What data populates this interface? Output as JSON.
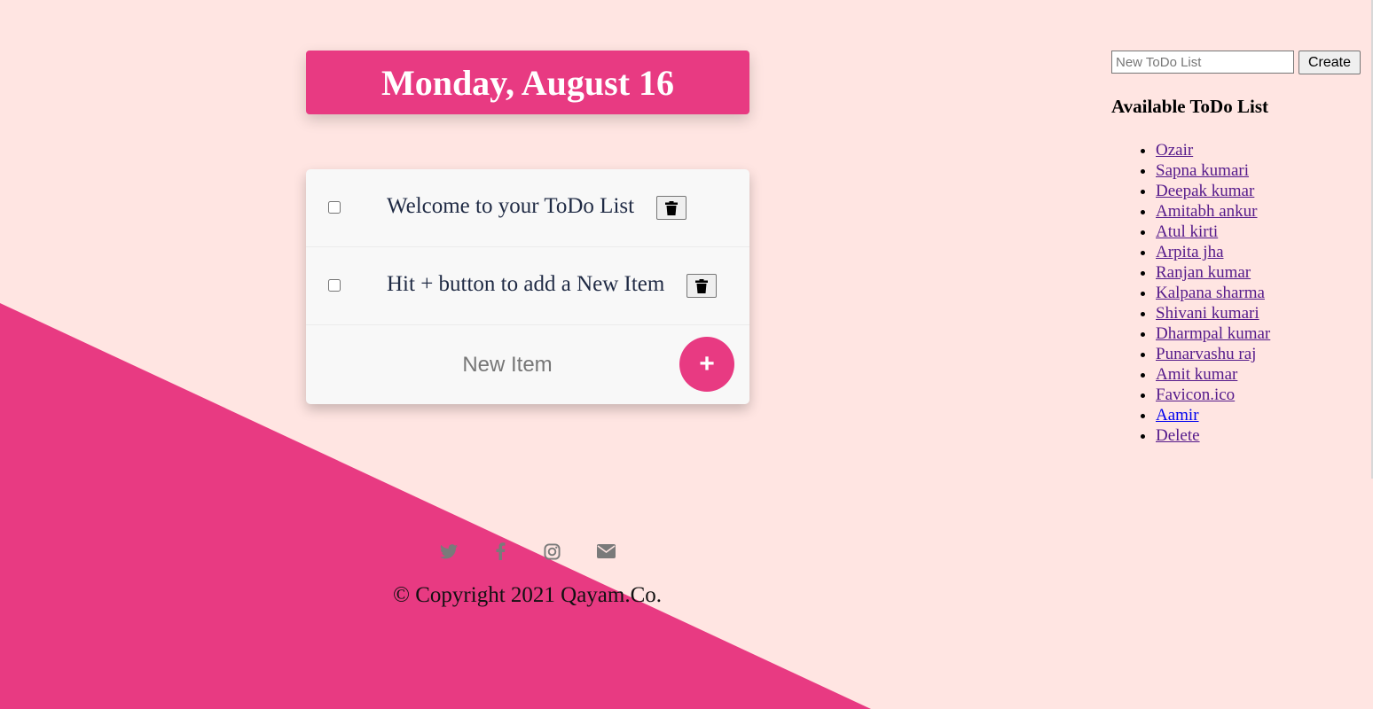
{
  "header": {
    "date_title": "Monday, August 16"
  },
  "todo": {
    "items": [
      {
        "text": "Welcome to your ToDo List",
        "checked": false
      },
      {
        "text": "Hit + button to add a New Item",
        "checked": false
      }
    ],
    "new_item_placeholder": "New Item",
    "add_button_label": "+"
  },
  "footer": {
    "social_icons": [
      "twitter-icon",
      "facebook-icon",
      "instagram-icon",
      "envelope-icon"
    ],
    "copyright": "© Copyright 2021 Qayam.Co."
  },
  "sidebar": {
    "new_list_placeholder": "New ToDo List",
    "create_label": "Create",
    "heading": "Available ToDo List",
    "lists": [
      {
        "label": "Ozair",
        "visited": true
      },
      {
        "label": "Sapna kumari",
        "visited": true
      },
      {
        "label": "Deepak kumar",
        "visited": true
      },
      {
        "label": "Amitabh ankur",
        "visited": true
      },
      {
        "label": "Atul kirti",
        "visited": true
      },
      {
        "label": "Arpita jha",
        "visited": true
      },
      {
        "label": "Ranjan kumar",
        "visited": true
      },
      {
        "label": "Kalpana sharma",
        "visited": true
      },
      {
        "label": "Shivani kumari",
        "visited": true
      },
      {
        "label": "Dharmpal kumar",
        "visited": true
      },
      {
        "label": "Punarvashu raj",
        "visited": true
      },
      {
        "label": "Amit kumar",
        "visited": true
      },
      {
        "label": "Favicon.ico",
        "visited": true
      },
      {
        "label": "Aamir",
        "visited": false
      },
      {
        "label": "Delete",
        "visited": true
      }
    ]
  },
  "colors": {
    "background": "#ffe5e2",
    "accent": "#e83a82",
    "card": "#f8f8f8",
    "visited_link": "#551a8b",
    "unvisited_link": "#0000ee"
  }
}
